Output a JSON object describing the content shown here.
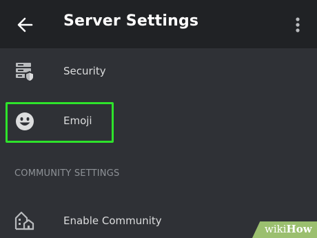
{
  "header": {
    "title": "Server Settings",
    "back_icon": "arrow-left-icon",
    "menu_icon": "more-vertical-icon"
  },
  "items": [
    {
      "label": "Security",
      "icon": "server-shield-icon"
    },
    {
      "label": "Emoji",
      "icon": "smiley-face-icon",
      "highlighted": true
    }
  ],
  "community_section": {
    "header": "COMMUNITY SETTINGS",
    "items": [
      {
        "label": "Enable Community",
        "icon": "community-buildings-icon"
      }
    ]
  },
  "watermark": {
    "prefix": "wiki",
    "suffix": "How"
  },
  "colors": {
    "background": "#2f3136",
    "header_background": "#202225",
    "text": "#dcddde",
    "section_text": "#8e9297",
    "highlight": "#2ee32b",
    "watermark_background": "#9bbf6f"
  }
}
